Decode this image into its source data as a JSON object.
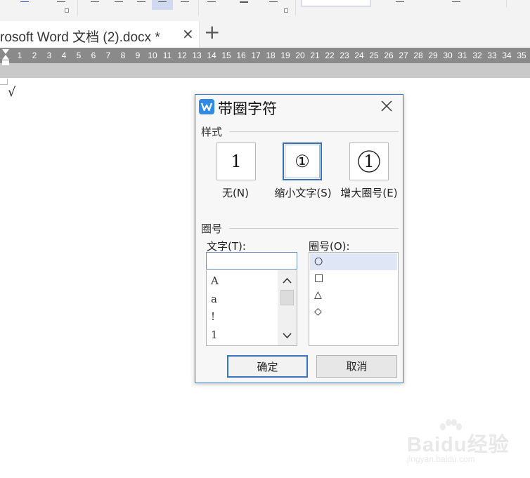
{
  "document_tab": {
    "title": "rosoft Word 文档 (2).docx *",
    "close_glyph": "×",
    "new_tab_glyph": "+"
  },
  "ruler": {
    "numbers": [
      "1",
      "2",
      "3",
      "4",
      "5",
      "6",
      "7",
      "8",
      "9",
      "10",
      "11",
      "12",
      "13",
      "14",
      "15",
      "16",
      "17",
      "18",
      "19",
      "20",
      "21",
      "22",
      "23",
      "24",
      "25",
      "26",
      "27",
      "28",
      "29",
      "30",
      "31",
      "32",
      "33",
      "34",
      "35"
    ]
  },
  "document": {
    "content": "√"
  },
  "dialog": {
    "title": "带圈字符",
    "style_section": "样式",
    "styles": [
      {
        "label": "无(N)",
        "glyph": "1",
        "selected": false
      },
      {
        "label": "缩小文字(S)",
        "glyph": "①",
        "selected": true
      },
      {
        "label": "增大圈号(E)",
        "glyph": "1",
        "selected": false
      }
    ],
    "enclosure_section": "圈号",
    "text_label": "文字(T):",
    "text_value": "",
    "text_items": [
      "A",
      "a",
      "!",
      "1"
    ],
    "circle_label": "圈号(O):",
    "circle_items": [
      "○",
      "□",
      "△",
      "◇"
    ],
    "selected_circle": 0,
    "ok_label": "确定",
    "cancel_label": "取消"
  },
  "watermark": {
    "brand": "Baidu",
    "brand_suffix": "经验",
    "url": "jingyan.baidu.com"
  },
  "colors": {
    "accent": "#2b7bd6",
    "ruler": "#8a8a8a",
    "selection": "#dfe7f7"
  },
  "icons": [
    "wps-app-icon",
    "close-icon",
    "plus-icon",
    "scroll-up-icon",
    "scroll-down-icon",
    "indent-marker-icon"
  ]
}
